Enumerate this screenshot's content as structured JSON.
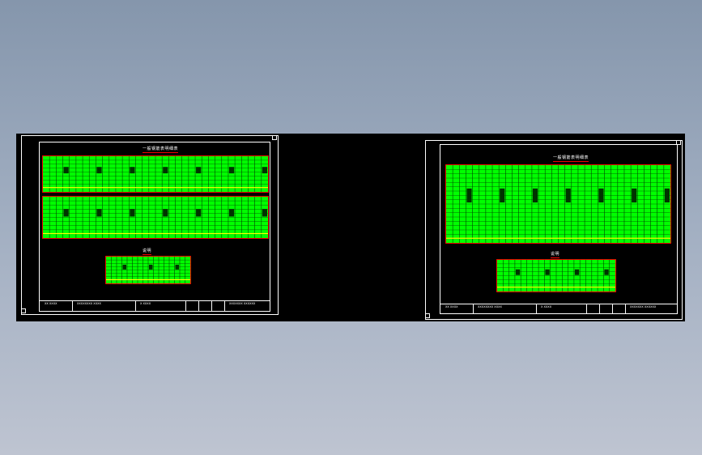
{
  "colors": {
    "background_top": "#8596ac",
    "background_bottom": "#bec4d1",
    "viewport": "#000000",
    "grid_fill": "#00ff00",
    "grid_lines": "#004400",
    "border": "#ff0000",
    "highlight": "#ffff00",
    "frame": "#ffffff"
  },
  "sheets": [
    {
      "title": "一般钢筋表明细表",
      "table_title": "说明",
      "title_block": {
        "cells": [
          "XX XXXX",
          "XXXXXXXX XXXX",
          "X XXXX",
          "XXXXXXX XXXXXX"
        ]
      }
    },
    {
      "title": "一般钢筋表明细表",
      "table_title": "说明",
      "title_block": {
        "cells": [
          "XX XXXX",
          "XXXXXXXX XXXX",
          "X XXXX",
          "XXXXXXX XXXXXX"
        ]
      }
    }
  ]
}
